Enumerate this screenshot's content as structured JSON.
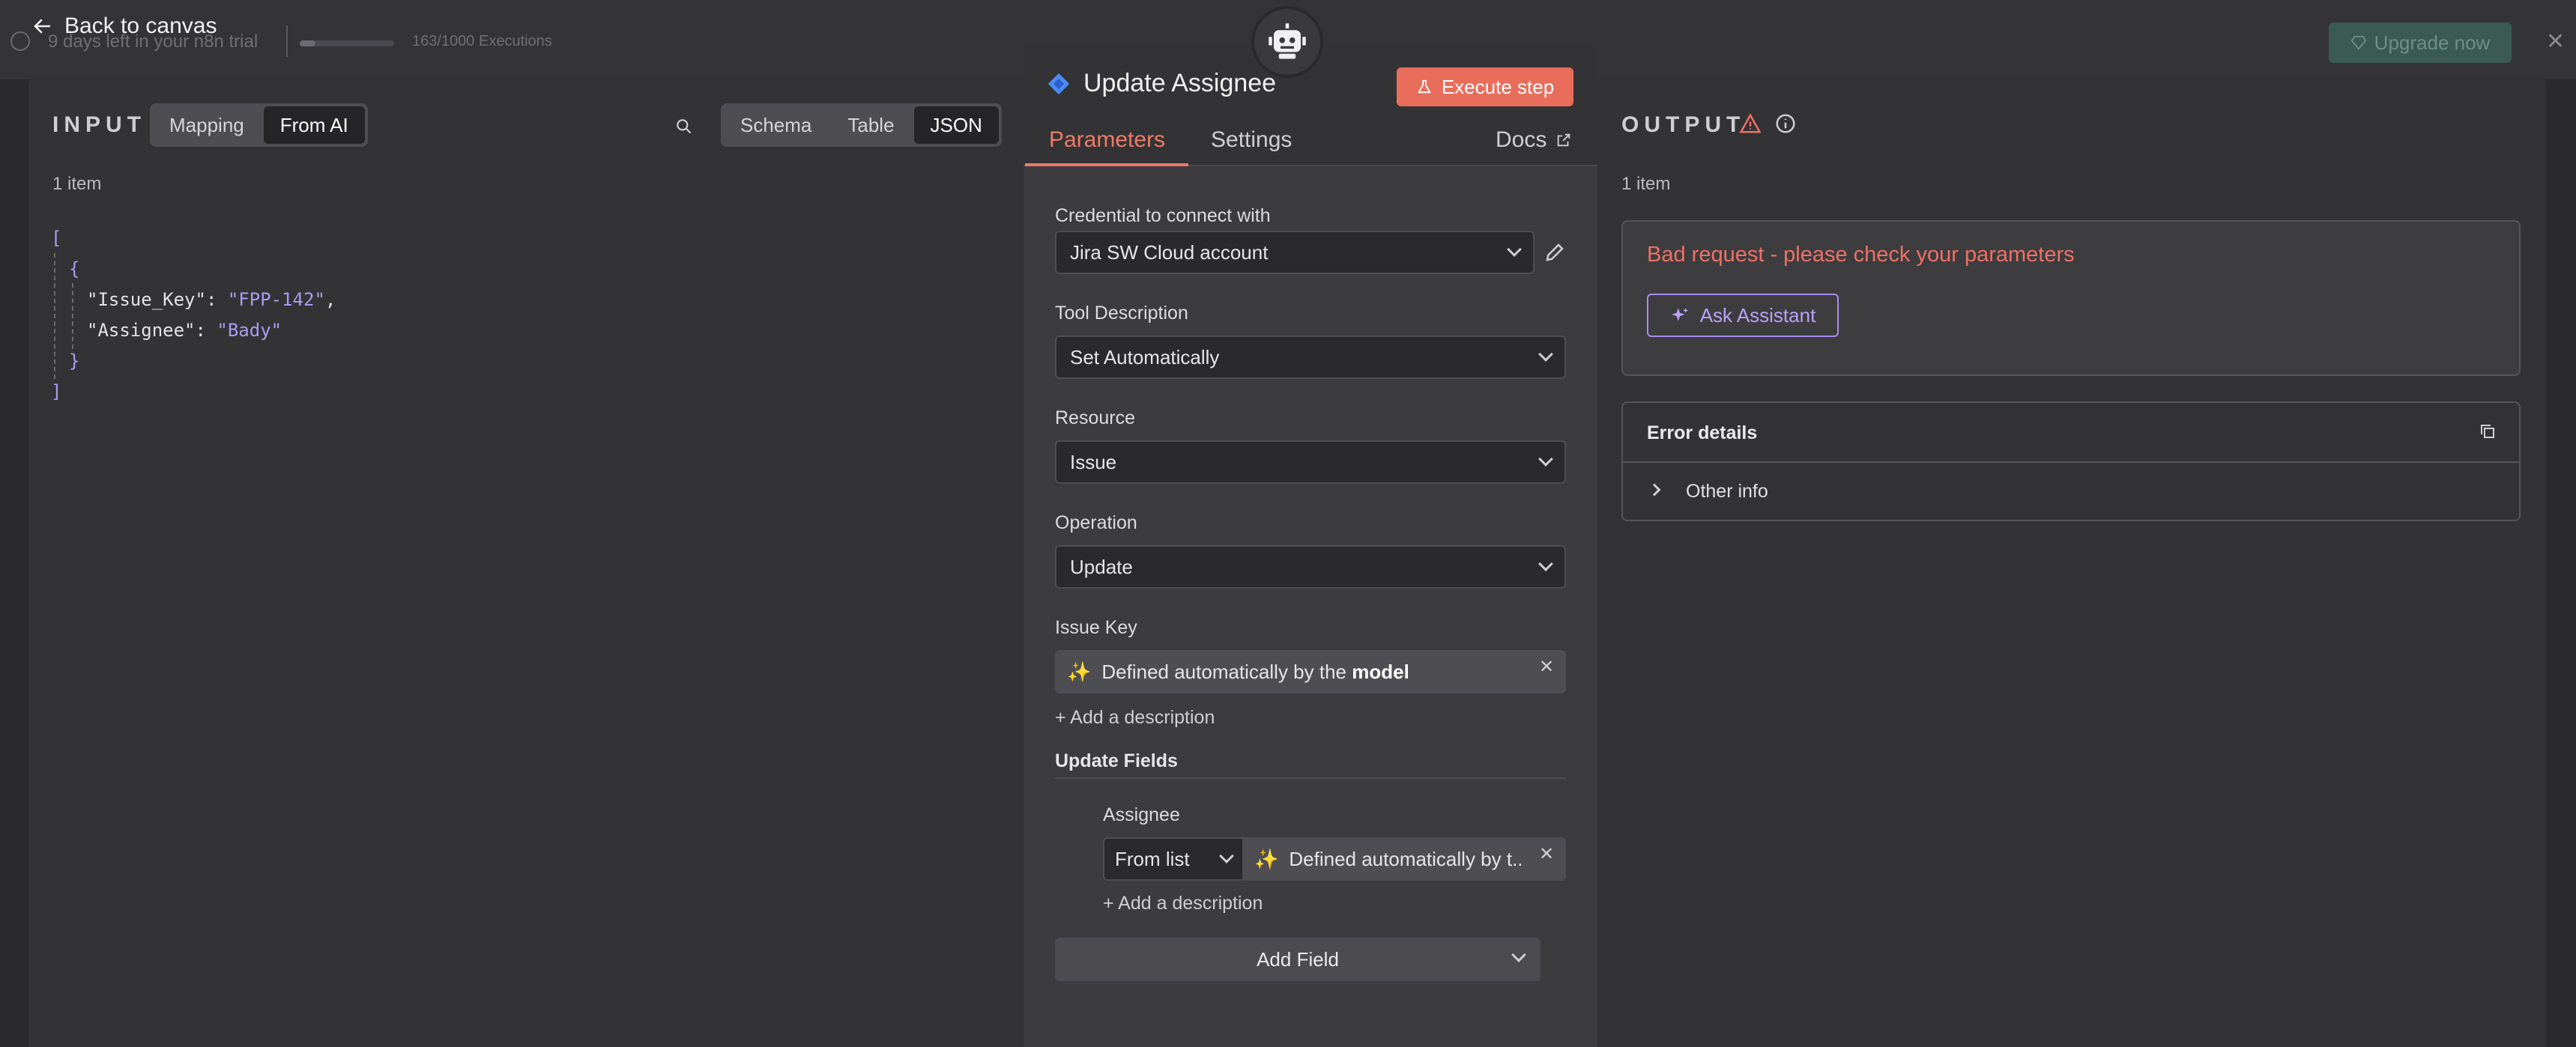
{
  "topbar": {
    "trial_text": "9 days left in your n8n trial",
    "executions": "163/1000 Executions",
    "executions_used": 163,
    "executions_total": 1000,
    "upgrade_label": "Upgrade now",
    "back_label": "Back to canvas"
  },
  "input": {
    "title": "INPUT",
    "mode_tabs": [
      "Mapping",
      "From AI"
    ],
    "active_mode": "From AI",
    "view_tabs": [
      "Schema",
      "Table",
      "JSON"
    ],
    "active_view": "JSON",
    "count": "1 item",
    "json": {
      "open_bracket": "[",
      "open_brace": "{",
      "line1_key": "\"Issue_Key\":",
      "line1_val": "\"FPP-142\"",
      "line1_comma": ",",
      "line2_key": "\"Assignee\":",
      "line2_val": "\"Bady\"",
      "close_brace": "}",
      "close_bracket": "]"
    }
  },
  "node": {
    "title": "Update Assignee",
    "execute_label": "Execute step",
    "tabs": [
      "Parameters",
      "Settings"
    ],
    "active_tab": "Parameters",
    "docs_label": "Docs",
    "credential_label": "Credential to connect with",
    "credential_value": "Jira SW Cloud account",
    "tool_desc_label": "Tool Description",
    "tool_desc_value": "Set Automatically",
    "resource_label": "Resource",
    "resource_value": "Issue",
    "operation_label": "Operation",
    "operation_value": "Update",
    "issue_key_label": "Issue Key",
    "issue_key_ai_prefix": "Defined automatically by the",
    "issue_key_ai_bold": "model",
    "add_description": "+ Add a description",
    "update_fields_label": "Update Fields",
    "assignee_label": "Assignee",
    "assignee_mode": "From list",
    "assignee_ai_text": "Defined automatically by t...",
    "add_description_2": "+ Add a description",
    "add_field_label": "Add Field"
  },
  "output": {
    "title": "OUTPUT",
    "count": "1 item",
    "error_title": "Bad request - please check your parameters",
    "assistant_label": "Ask Assistant",
    "details_title": "Error details",
    "other_info": "Other info"
  },
  "colors": {
    "accent": "#ef7a67",
    "execute": "#e96d5b",
    "error": "#ef7064",
    "assistant": "#a98bf0",
    "json_string": "#a99cf3"
  }
}
